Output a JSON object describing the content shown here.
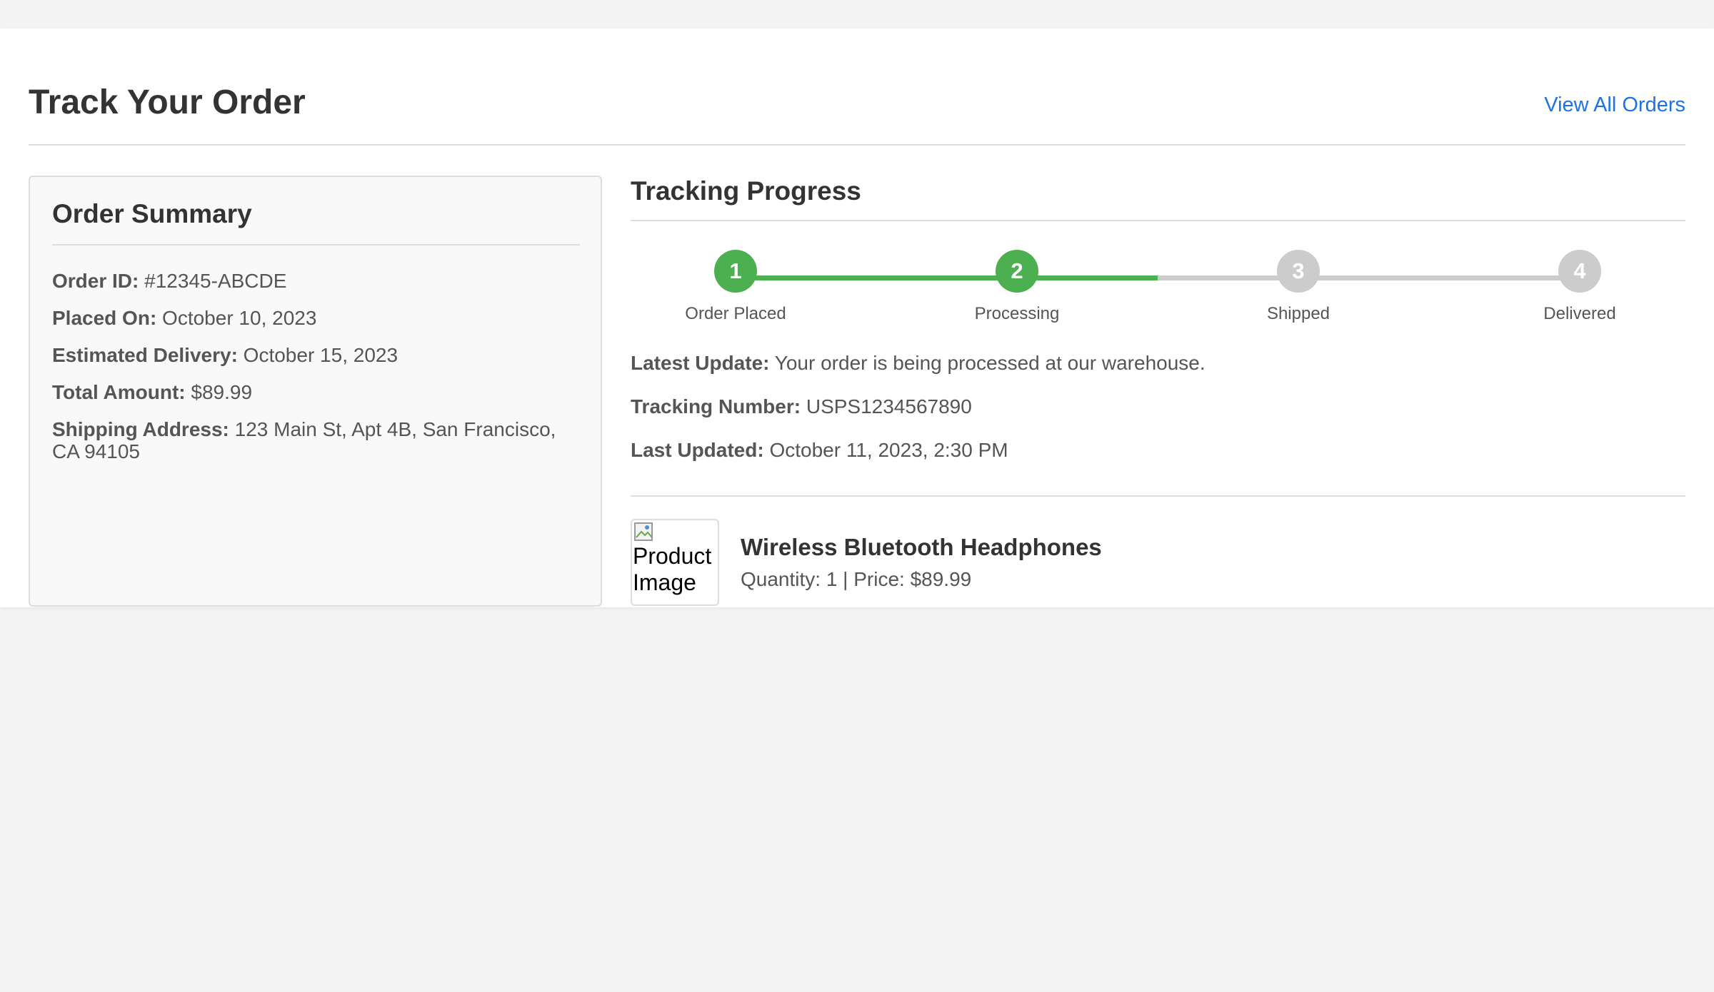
{
  "header": {
    "title": "Track Your Order",
    "view_all_label": "View All Orders"
  },
  "summary": {
    "title": "Order Summary",
    "rows": [
      {
        "label": "Order ID:",
        "value": "#12345-ABCDE"
      },
      {
        "label": "Placed On:",
        "value": "October 10, 2023"
      },
      {
        "label": "Estimated Delivery:",
        "value": "October 15, 2023"
      },
      {
        "label": "Total Amount:",
        "value": "$89.99"
      },
      {
        "label": "Shipping Address:",
        "value": "123 Main St, Apt 4B, San Francisco, CA 94105"
      }
    ]
  },
  "tracking": {
    "title": "Tracking Progress",
    "steps": [
      {
        "number": "1",
        "label": "Order Placed",
        "completed": true
      },
      {
        "number": "2",
        "label": "Processing",
        "completed": true
      },
      {
        "number": "3",
        "label": "Shipped",
        "completed": false
      },
      {
        "number": "4",
        "label": "Delivered",
        "completed": false
      }
    ],
    "details": [
      {
        "label": "Latest Update:",
        "value": "Your order is being processed at our warehouse."
      },
      {
        "label": "Tracking Number:",
        "value": "USPS1234567890"
      },
      {
        "label": "Last Updated:",
        "value": "October 11, 2023, 2:30 PM"
      }
    ]
  },
  "product": {
    "image_alt": "Product Image",
    "name": "Wireless Bluetooth Headphones",
    "meta": "Quantity: 1 | Price: $89.99"
  },
  "colors": {
    "complete": "#4caf50",
    "pending": "#cccccc",
    "link": "#1a73e8"
  }
}
